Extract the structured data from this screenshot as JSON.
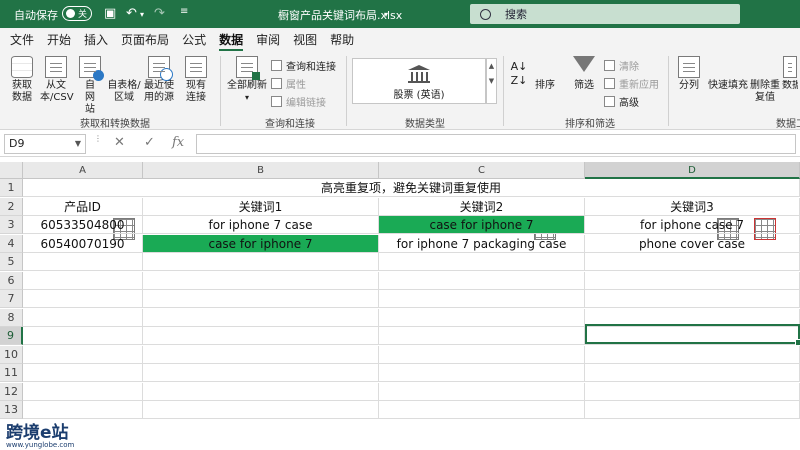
{
  "titlebar": {
    "autosave_label": "自动保存",
    "autosave_toggle": "关",
    "file_title": "橱窗产品关键词布局.xlsx",
    "search_placeholder": "搜索"
  },
  "ribbon_tabs": [
    "文件",
    "开始",
    "插入",
    "页面布局",
    "公式",
    "数据",
    "审阅",
    "视图",
    "帮助"
  ],
  "active_tab": "数据",
  "ribbon": {
    "get_data": "获取数据",
    "from_text_csv": "从文本/CSV",
    "from_web": "自网站",
    "from_table": "自表格/区域",
    "recent_sources": "最近使用的源",
    "existing_connections": "现有连接",
    "group_get_transform": "获取和转换数据",
    "refresh_all": "全部刷新",
    "queries_connections": "查询和连接",
    "properties": "属性",
    "edit_links": "编辑链接",
    "group_queries": "查询和连接",
    "stocks": "股票 (英语)",
    "group_datatypes": "数据类型",
    "sort": "排序",
    "filter": "筛选",
    "clear": "清除",
    "reapply": "重新应用",
    "advanced": "高级",
    "group_sort_filter": "排序和筛选",
    "text_to_columns": "分列",
    "flash_fill": "快速填充",
    "remove_duplicates": "删除重复值",
    "data_validation": "数据验证",
    "group_data_tools": "数据工具"
  },
  "formula_bar": {
    "name_box": "D9",
    "cancel": "✕",
    "enter": "✓",
    "fx": "fx",
    "value": ""
  },
  "sheet": {
    "columns": [
      "A",
      "B",
      "C",
      "D"
    ],
    "selected_column": "D",
    "rows": [
      "1",
      "2",
      "3",
      "4",
      "5",
      "6",
      "7",
      "8",
      "9",
      "10",
      "11",
      "12",
      "13"
    ],
    "selected_row": "9",
    "title": "高亮重复项，避免关键词重复使用",
    "headers": [
      "产品ID",
      "关键词1",
      "关键词2",
      "关键词3"
    ],
    "data": [
      [
        "60533504800",
        "for iphone 7 case",
        "case for iphone 7",
        "for iphone case 7"
      ],
      [
        "60540070190",
        "case for iphone 7",
        "for iphone 7 packaging case",
        "phone cover case"
      ]
    ],
    "highlight_color": "#1aaa55"
  },
  "watermark": {
    "brand": "跨境e站",
    "url": "www.yunglobe.com"
  }
}
